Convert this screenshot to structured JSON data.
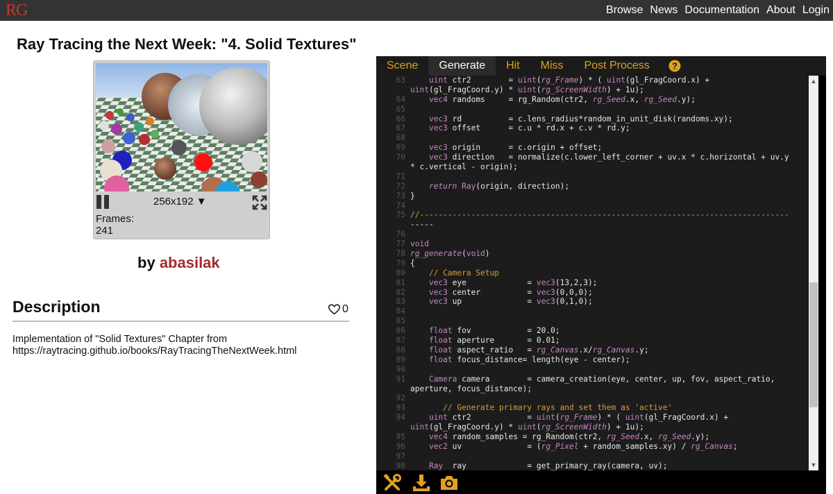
{
  "header": {
    "logo": "RG",
    "nav": [
      "Browse",
      "News",
      "Documentation",
      "About",
      "Login"
    ]
  },
  "page": {
    "title": "Ray Tracing the Next Week: \"4. Solid Textures\"",
    "by_label": "by",
    "author": "abasilak"
  },
  "player": {
    "resolution": "256x192 ▼",
    "frames_label": "Frames:",
    "frames_value": "241"
  },
  "description": {
    "heading": "Description",
    "likes": "0",
    "text_line1": "Implementation of \"Solid Textures\" Chapter from",
    "text_line2": "https://raytracing.github.io/books/RayTracingTheNextWeek.html"
  },
  "editor": {
    "tabs": [
      "Scene",
      "Generate",
      "Hit",
      "Miss",
      "Post Process"
    ],
    "active_tab": "Generate",
    "code_lines": [
      {
        "n": "63",
        "t": "    uint ctr2        = uint(rg_Frame) * ( uint(gl_FragCoord.x) +"
      },
      {
        "n": "",
        "t": "uint(gl_FragCoord.y) * uint(rg_ScreenWidth) + 1u);"
      },
      {
        "n": "64",
        "t": "    vec4 randoms     = rg_Random(ctr2, rg_Seed.x, rg_Seed.y);"
      },
      {
        "n": "65",
        "t": ""
      },
      {
        "n": "66",
        "t": "    vec3 rd          = c.lens_radius*random_in_unit_disk(randoms.xy);"
      },
      {
        "n": "67",
        "t": "    vec3 offset      = c.u * rd.x + c.v * rd.y;"
      },
      {
        "n": "68",
        "t": ""
      },
      {
        "n": "69",
        "t": "    vec3 origin      = c.origin + offset;"
      },
      {
        "n": "70",
        "t": "    vec3 direction   = normalize(c.lower_left_corner + uv.x * c.horizontal + uv.y"
      },
      {
        "n": "",
        "t": "* c.vertical - origin);"
      },
      {
        "n": "71",
        "t": ""
      },
      {
        "n": "72",
        "t": "    return Ray(origin, direction);"
      },
      {
        "n": "73",
        "t": "}"
      },
      {
        "n": "74",
        "t": ""
      },
      {
        "n": "75",
        "t": "//-------------------------------------------------------------------------------"
      },
      {
        "n": "",
        "t": "-----"
      },
      {
        "n": "76",
        "t": ""
      },
      {
        "n": "77",
        "t": "void"
      },
      {
        "n": "78",
        "t": "rg_generate(void)"
      },
      {
        "n": "79",
        "t": "{"
      },
      {
        "n": "80",
        "t": "    // Camera Setup"
      },
      {
        "n": "81",
        "t": "    vec3 eye             = vec3(13,2,3);"
      },
      {
        "n": "82",
        "t": "    vec3 center          = vec3(0,0,0);"
      },
      {
        "n": "83",
        "t": "    vec3 up              = vec3(0,1,0);"
      },
      {
        "n": "84",
        "t": ""
      },
      {
        "n": "85",
        "t": ""
      },
      {
        "n": "86",
        "t": "    float fov            = 20.0;"
      },
      {
        "n": "87",
        "t": "    float aperture       = 0.01;"
      },
      {
        "n": "88",
        "t": "    float aspect_ratio   = rg_Canvas.x/rg_Canvas.y;"
      },
      {
        "n": "89",
        "t": "    float focus_distance= length(eye - center);"
      },
      {
        "n": "90",
        "t": ""
      },
      {
        "n": "91",
        "t": "    Camera camera        = camera_creation(eye, center, up, fov, aspect_ratio,"
      },
      {
        "n": "",
        "t": "aperture, focus_distance);"
      },
      {
        "n": "92",
        "t": ""
      },
      {
        "n": "93",
        "t": "       // Generate primary rays and set them as 'active'"
      },
      {
        "n": "94",
        "t": "    uint ctr2            = uint(rg_Frame) * ( uint(gl_FragCoord.x) +"
      },
      {
        "n": "",
        "t": "uint(gl_FragCoord.y) * uint(rg_ScreenWidth) + 1u);"
      },
      {
        "n": "95",
        "t": "    vec4 random_samples = rg_Random(ctr2, rg_Seed.x, rg_Seed.y);"
      },
      {
        "n": "96",
        "t": "    vec2 uv              = (rg_Pixel + random_samples.xy) / rg_Canvas;"
      },
      {
        "n": "97",
        "t": ""
      },
      {
        "n": "98",
        "t": "    Ray  ray             = get_primary_ray(camera, uv);"
      }
    ]
  },
  "colors": {
    "topbar": "#333333",
    "logo": "#c0392b",
    "author": "#a52a2a",
    "tab_text": "#e2a020",
    "toolbar_icon": "#e2a020"
  },
  "icons": [
    "pause-icon",
    "fullscreen-icon",
    "heart-icon",
    "help-icon",
    "tools-icon",
    "download-icon",
    "camera-icon"
  ]
}
